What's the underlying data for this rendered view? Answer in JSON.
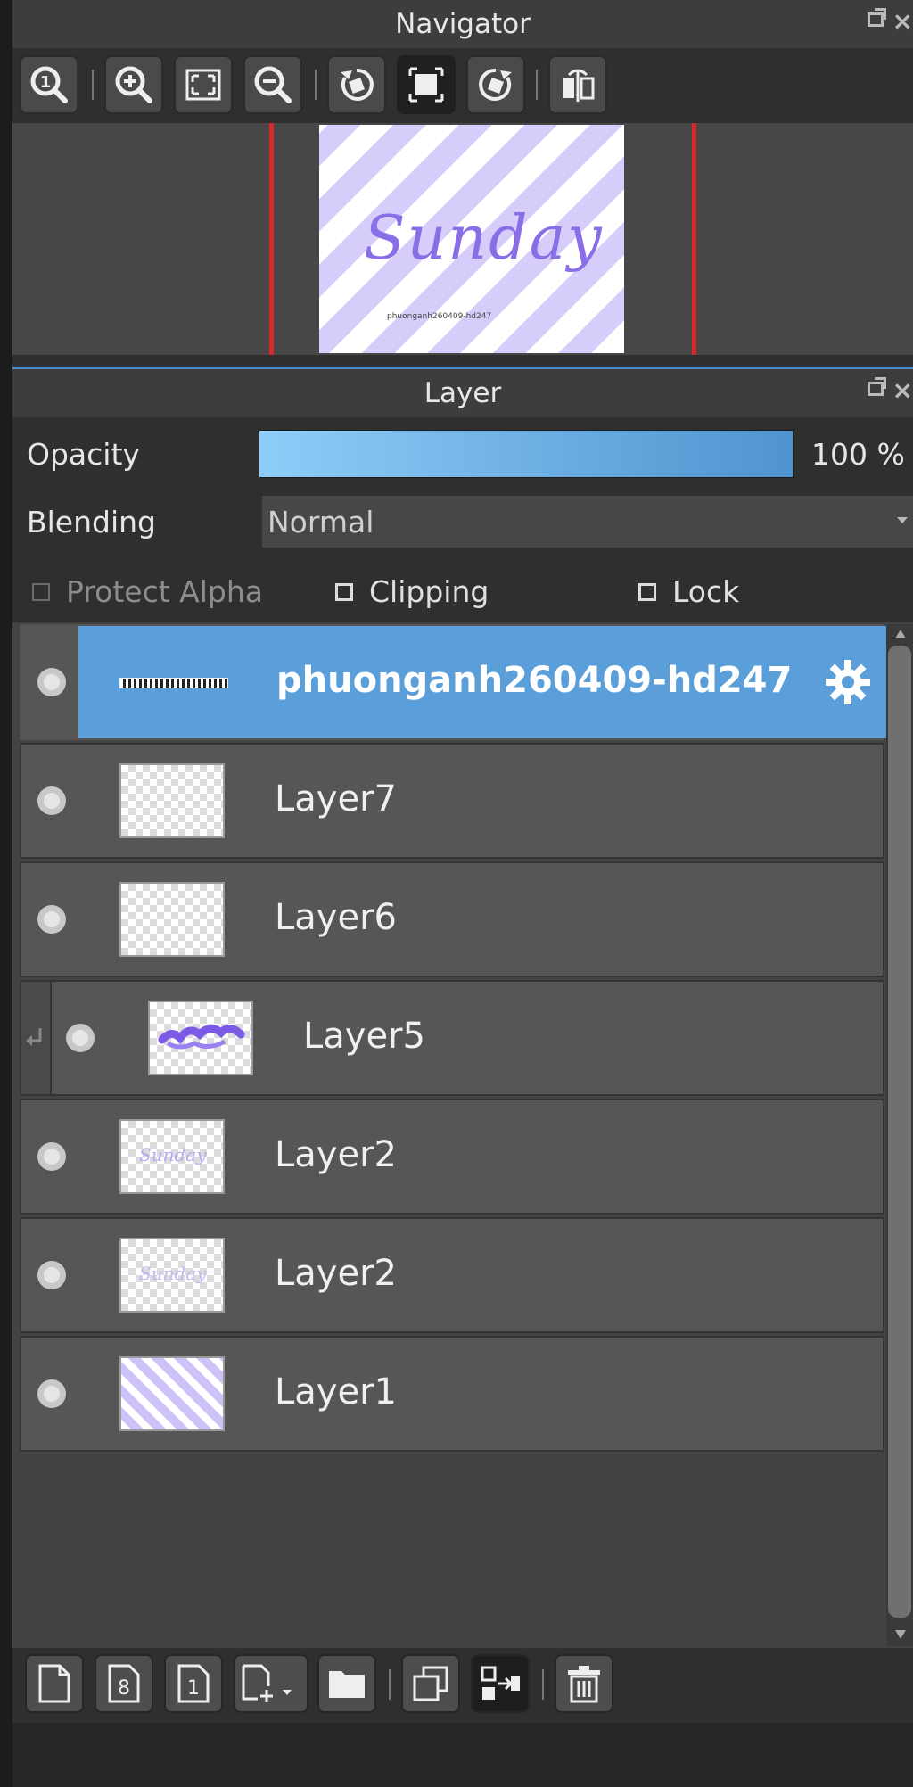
{
  "navigator": {
    "title": "Navigator",
    "preview_text": "Sunday",
    "preview_subtext": "phuonganh260409-hd247"
  },
  "layer_panel": {
    "title": "Layer",
    "opacity_label": "Opacity",
    "opacity_value": "100 %",
    "opacity_fraction": 1.0,
    "blending_label": "Blending",
    "blending_value": "Normal",
    "protect_alpha_label": "Protect Alpha",
    "clipping_label": "Clipping",
    "lock_label": "Lock"
  },
  "layers": [
    {
      "name": "phuonganh260409-hd247",
      "selected": true
    },
    {
      "name": "Layer7"
    },
    {
      "name": "Layer6"
    },
    {
      "name": "Layer5",
      "clipped": true
    },
    {
      "name": "Layer2"
    },
    {
      "name": "Layer2"
    },
    {
      "name": "Layer1"
    }
  ],
  "colors": {
    "accent": "#5a9fda",
    "opacity_bar_start": "#8ecdf8",
    "opacity_bar_end": "#4f94d0",
    "stripe_purple": "#d7cdfa",
    "text_purple": "#8a6ee8",
    "red_guide": "#d42a2a"
  },
  "icons": {
    "toolbar_top": [
      "zoom-actual-icon",
      "zoom-in-icon",
      "fit-screen-icon",
      "zoom-out-icon",
      "rotate-left-icon",
      "reset-rotation-icon",
      "rotate-right-icon",
      "flip-horizontal-icon"
    ],
    "toolbar_bottom": [
      "new-layer-icon",
      "new-8bit-layer-icon",
      "new-1bit-layer-icon",
      "add-layer-menu-icon",
      "new-folder-icon",
      "duplicate-layer-icon",
      "merge-down-icon",
      "delete-layer-icon"
    ]
  }
}
